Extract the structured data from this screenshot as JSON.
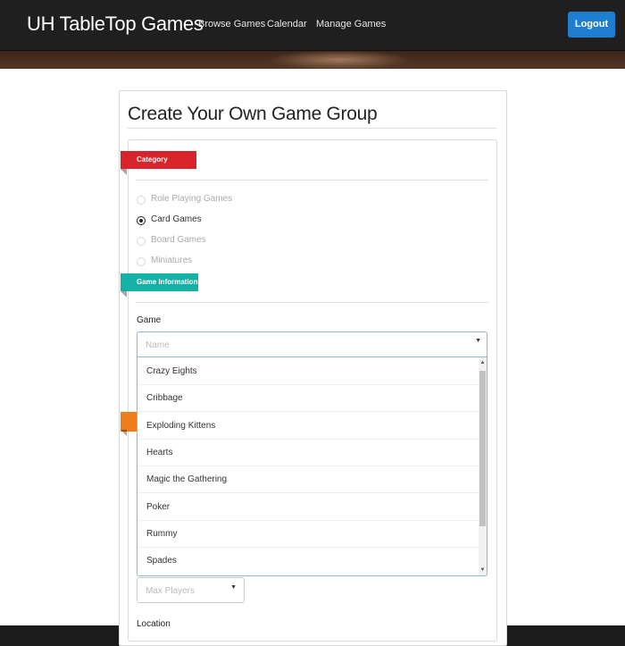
{
  "navbar": {
    "brand": "UH TableTop Games",
    "links": [
      "Browse Games",
      "Calendar",
      "Manage Games"
    ],
    "logout_label": "Logout"
  },
  "page": {
    "title": "Create Your Own Game Group"
  },
  "category": {
    "ribbon_label": "Category",
    "options": [
      {
        "label": "Role Playing Games",
        "checked": false
      },
      {
        "label": "Card Games",
        "checked": true
      },
      {
        "label": "Board Games",
        "checked": false
      },
      {
        "label": "Miniatures",
        "checked": false
      }
    ]
  },
  "game_information": {
    "ribbon_label": "Game Information",
    "game_label": "Game",
    "game_placeholder": "Name",
    "game_options": [
      "Crazy Eights",
      "Cribbage",
      "Exploding Kittens",
      "Hearts",
      "Magic the Gathering",
      "Poker",
      "Rummy",
      "Spades"
    ],
    "max_players_placeholder": "Max Players",
    "location_label": "Location"
  },
  "colors": {
    "category_ribbon": "#d9232b",
    "game_info_ribbon": "#15b1a6",
    "third_ribbon": "#ef7b1a",
    "logout_button": "#1f7ed0"
  }
}
